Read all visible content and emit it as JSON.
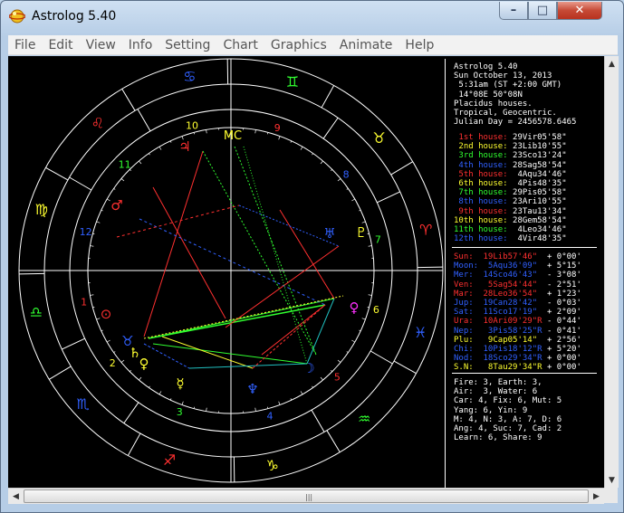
{
  "window": {
    "title": "Astrolog 5.40"
  },
  "controls": {
    "minimize": "–",
    "maximize": "□",
    "close": "✕"
  },
  "menu": [
    "File",
    "Edit",
    "View",
    "Info",
    "Setting",
    "Chart",
    "Graphics",
    "Animate",
    "Help"
  ],
  "colors": {
    "background": "#000000",
    "wheel": "#ffffff",
    "fire": "#ff3030",
    "earth": "#ffff00",
    "air": "#00cc00",
    "water": "#2060ff"
  },
  "header": [
    "Astrolog 5.40",
    "Sun October 13, 2013",
    " 5:31am (ST +2:00 GMT)",
    " 14°08E 50°08N",
    "Placidus houses.",
    "Tropical, Geocentric.",
    "Julian Day = 2456578.6465"
  ],
  "houses": [
    {
      "label": "1st house:",
      "value": "29Vir05'58\"",
      "color": "#ff3030"
    },
    {
      "label": "2nd house:",
      "value": "23Lib10'55\"",
      "color": "#ffff30"
    },
    {
      "label": "3rd house:",
      "value": "23Sco13'24\"",
      "color": "#30ff30"
    },
    {
      "label": "4th house:",
      "value": "28Sag58'54\"",
      "color": "#3060ff"
    },
    {
      "label": "5th house:",
      "value": " 4Aqu34'46\"",
      "color": "#ff3030"
    },
    {
      "label": "6th house:",
      "value": " 4Pis48'35\"",
      "color": "#ffff30"
    },
    {
      "label": "7th house:",
      "value": "29Pis05'58\"",
      "color": "#30ff30"
    },
    {
      "label": "8th house:",
      "value": "23Ari10'55\"",
      "color": "#3060ff"
    },
    {
      "label": "9th house:",
      "value": "23Tau13'34\"",
      "color": "#ff3030"
    },
    {
      "label": "10th house:",
      "value": "28Gem58'54\"",
      "color": "#ffff30"
    },
    {
      "label": "11th house:",
      "value": " 4Leo34'46\"",
      "color": "#30ff30"
    },
    {
      "label": "12th house:",
      "value": " 4Vir48'35\"",
      "color": "#3060ff"
    }
  ],
  "planets": [
    {
      "name": "Sun:",
      "pos": "19Lib57'46\"",
      "rest": "  + 0°00'",
      "color": "#ff3030"
    },
    {
      "name": "Moon:",
      "pos": " 5Aqu36'09\"",
      "rest": "  + 5°15'",
      "color": "#3060ff"
    },
    {
      "name": "Mer:",
      "pos": "14Sco46'43\"",
      "rest": "  - 3°08'",
      "color": "#3060ff"
    },
    {
      "name": "Ven:",
      "pos": " 5Sag54'44\"",
      "rest": "  - 2°51'",
      "color": "#ff3030"
    },
    {
      "name": "Mar:",
      "pos": "28Leo36'54\"",
      "rest": "  + 1°23'",
      "color": "#ff3030"
    },
    {
      "name": "Jup:",
      "pos": "19Can28'42\"",
      "rest": "  - 0°03'",
      "color": "#3060ff"
    },
    {
      "name": "Sat:",
      "pos": "11Sco17'19\"",
      "rest": "  + 2°09'",
      "color": "#3060ff"
    },
    {
      "name": "Ura:",
      "pos": "10Ari09'29\"R",
      "rest": " - 0°44'",
      "color": "#ff3030"
    },
    {
      "name": "Nep:",
      "pos": " 3Pis58'25\"R",
      "rest": " - 0°41'",
      "color": "#3060ff"
    },
    {
      "name": "Plu:",
      "pos": " 9Cap05'14\"",
      "rest": "  + 2°56'",
      "color": "#ffff30"
    },
    {
      "name": "Chi:",
      "pos": "10Pis18'12\"R",
      "rest": " + 5°20'",
      "color": "#3060ff"
    },
    {
      "name": "Nod:",
      "pos": "18Sco29'34\"R",
      "rest": " + 0°00'",
      "color": "#3060ff"
    },
    {
      "name": "S.N:",
      "pos": " 8Tau29'34\"R",
      "rest": " + 0°00'",
      "color": "#ffff30"
    }
  ],
  "elements": [
    "Fire: 3, Earth: 3,",
    "Air:  3, Water: 6",
    "Car: 4, Fix: 6, Mut: 5",
    "Yang: 6, Yin: 9",
    "M: 4, N: 3, A: 7, D: 6",
    "Ang: 4, Suc: 7, Cad: 2",
    "Learn: 6, Share: 9"
  ],
  "chart": {
    "house_numbers": [
      "1",
      "2",
      "3",
      "4",
      "5",
      "6",
      "7",
      "8",
      "9",
      "10",
      "11",
      "12"
    ],
    "signs": [
      {
        "name": "aries-sign",
        "glyph": "♈",
        "color": "#ff3030"
      },
      {
        "name": "taurus-sign",
        "glyph": "♉",
        "color": "#ffff30"
      },
      {
        "name": "gemini-sign",
        "glyph": "♊",
        "color": "#30ff30"
      },
      {
        "name": "cancer-sign",
        "glyph": "♋",
        "color": "#3060ff"
      },
      {
        "name": "leo-sign",
        "glyph": "♌",
        "color": "#ff3030"
      },
      {
        "name": "virgo-sign",
        "glyph": "♍",
        "color": "#ffff30"
      },
      {
        "name": "libra-sign",
        "glyph": "♎",
        "color": "#30ff30"
      },
      {
        "name": "scorpio-sign",
        "glyph": "♏",
        "color": "#3060ff"
      },
      {
        "name": "sagittarius-sign",
        "glyph": "♐",
        "color": "#ff3030"
      },
      {
        "name": "capricorn-sign",
        "glyph": "♑",
        "color": "#ffff30"
      },
      {
        "name": "aquarius-sign",
        "glyph": "♒",
        "color": "#30ff30"
      },
      {
        "name": "pisces-sign",
        "glyph": "♓",
        "color": "#3060ff"
      }
    ],
    "mc_label": "MC"
  }
}
